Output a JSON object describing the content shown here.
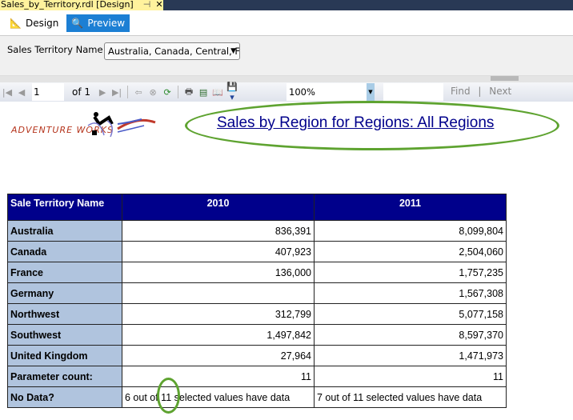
{
  "window": {
    "tab_title": "Sales_by_Territory.rdl [Design]",
    "pin": "⊣",
    "close": "✕"
  },
  "modes": {
    "design": "Design",
    "preview": "Preview"
  },
  "params": {
    "label": "Sales Territory Name",
    "value": "Australia, Canada, Central, F"
  },
  "toolbar": {
    "page": "1",
    "of_label": "of",
    "total_pages": "1",
    "zoom": "100%",
    "find": "Find",
    "separator": "|",
    "next": "Next"
  },
  "report": {
    "logo_text": "ADVENTURE WORKS",
    "title": "Sales by Region for Regions:  All Regions"
  },
  "table": {
    "headers": [
      "Sale Territory Name",
      "2010",
      "2011"
    ],
    "rows": [
      [
        "Australia",
        "836,391",
        "8,099,804"
      ],
      [
        "Canada",
        "407,923",
        "2,504,060"
      ],
      [
        "France",
        "136,000",
        "1,757,235"
      ],
      [
        "Germany",
        "",
        "1,567,308"
      ],
      [
        "Northwest",
        "312,799",
        "5,077,158"
      ],
      [
        "Southwest",
        "1,497,842",
        "8,597,370"
      ],
      [
        "United Kingdom",
        "27,964",
        "1,471,973"
      ],
      [
        "Parameter count:",
        "11",
        "11"
      ]
    ],
    "nodata": [
      "No Data?",
      "6 out of 11 selected values have data",
      "7 out of 11 selected values have data"
    ]
  },
  "colors": {
    "header_bg": "#00008b",
    "label_bg": "#b0c4de",
    "annotation": "#5ea330"
  }
}
